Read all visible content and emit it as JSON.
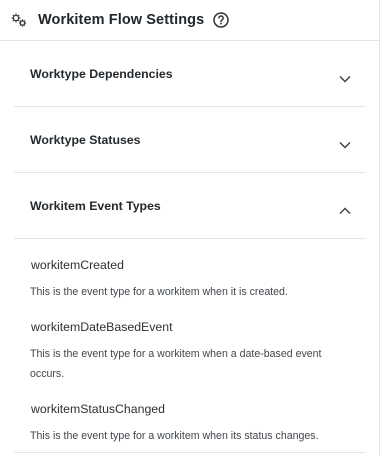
{
  "header": {
    "title": "Workitem Flow Settings",
    "settings_icon": "gears-icon",
    "help_icon": "question-circle-icon"
  },
  "sections": [
    {
      "label": "Worktype Dependencies",
      "expanded": false,
      "chevron": "chevron-down-icon"
    },
    {
      "label": "Worktype Statuses",
      "expanded": false,
      "chevron": "chevron-down-icon"
    },
    {
      "label": "Workitem Event Types",
      "expanded": true,
      "chevron": "chevron-up-icon"
    }
  ],
  "event_types": [
    {
      "name": "workitemCreated",
      "description": "This is the event type for a workitem when it is created."
    },
    {
      "name": "workitemDateBasedEvent",
      "description": "This is the event type for a workitem when a date-based event occurs."
    },
    {
      "name": "workitemStatusChanged",
      "description": "This is the event type for a workitem when its status changes."
    }
  ],
  "colors": {
    "text": "#2f3437",
    "divider": "#e2e5e9"
  }
}
